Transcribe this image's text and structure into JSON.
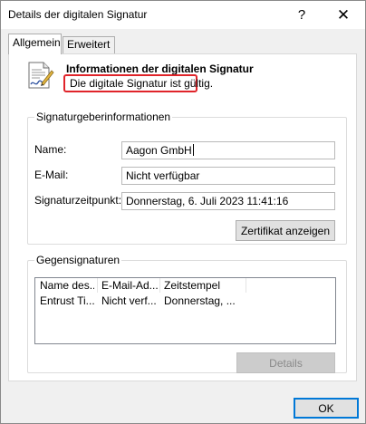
{
  "window": {
    "title": "Details der digitalen Signatur",
    "help_glyph": "?",
    "close_glyph": "✕"
  },
  "tabs": [
    {
      "label": "Allgemein",
      "active": true
    },
    {
      "label": "Erweitert",
      "active": false
    }
  ],
  "general": {
    "heading": "Informationen der digitalen Signatur",
    "status": "Die digitale Signatur ist gültig.",
    "status_highlight_color": "#e0242a"
  },
  "signer": {
    "legend": "Signaturgeberinformationen",
    "name_label": "Name:",
    "name_value": "Aagon GmbH",
    "email_label": "E-Mail:",
    "email_value": "Nicht verfügbar",
    "time_label": "Signaturzeitpunkt:",
    "time_value": "Donnerstag, 6. Juli 2023 11:41:16",
    "view_cert_button": "Zertifikat anzeigen"
  },
  "countersignatures": {
    "legend": "Gegensignaturen",
    "columns": [
      "Name des...",
      "E-Mail-Ad...",
      "Zeitstempel"
    ],
    "rows": [
      [
        "Entrust Ti...",
        "Nicht verf...",
        "Donnerstag, ..."
      ]
    ],
    "details_button": "Details"
  },
  "footer": {
    "ok_button": "OK"
  }
}
